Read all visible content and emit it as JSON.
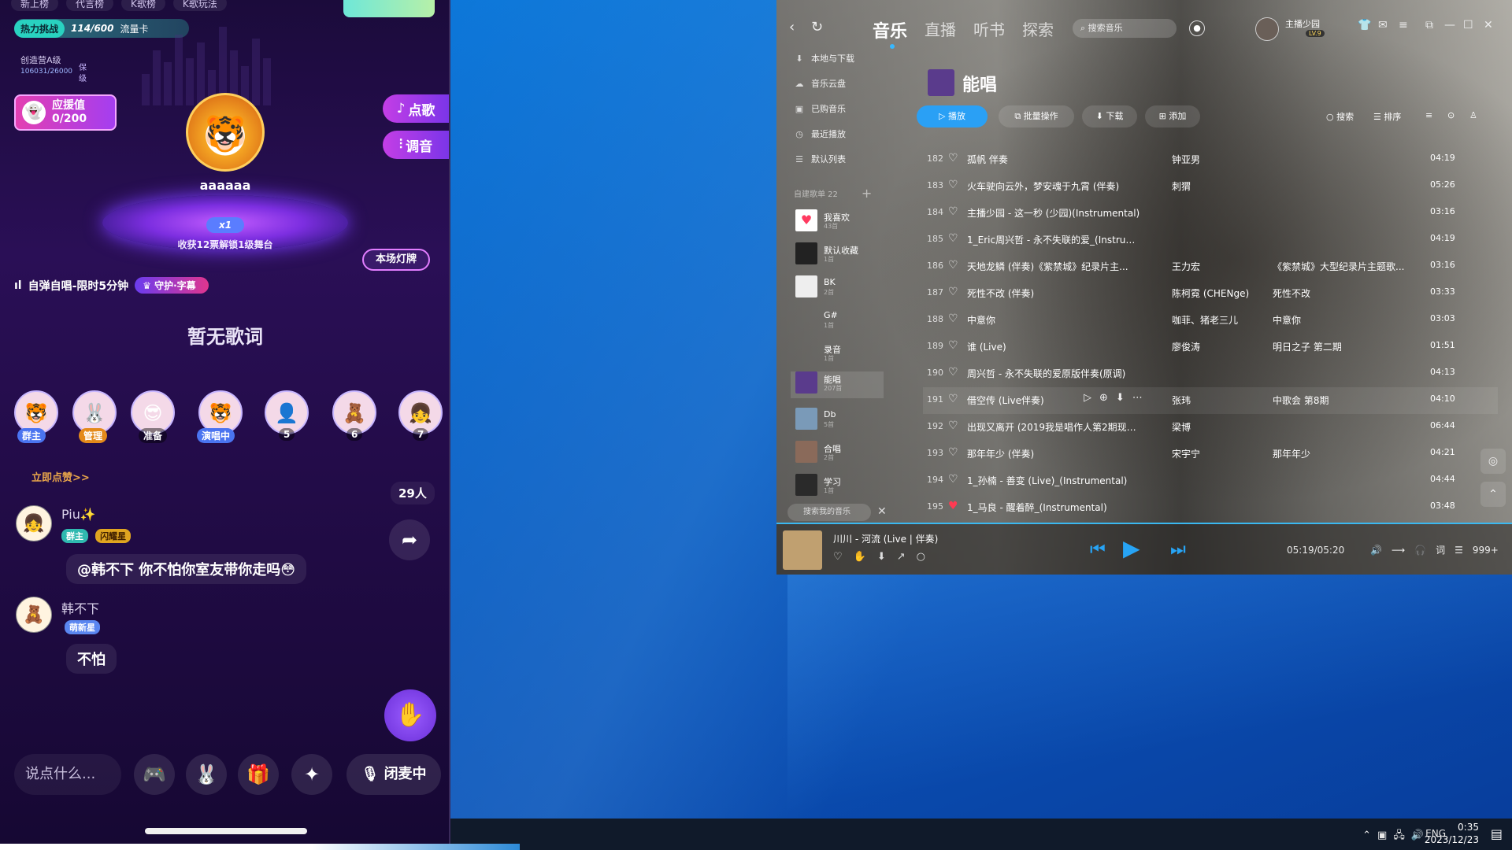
{
  "live_app": {
    "top_tabs": [
      "新上榜",
      "代言榜",
      "K歌榜",
      "K歌玩法"
    ],
    "hot_challenge": {
      "tag": "热力挑战",
      "count": "114/600",
      "card": "流量卡"
    },
    "rank": {
      "title": "创造营A级",
      "score": "106031/26000",
      "badge": "保级"
    },
    "support": {
      "label": "应援值",
      "value": "0/200"
    },
    "order_song": "点歌",
    "tune": "调音",
    "host_name": "aaaaaa",
    "stage_multiplier": "x1",
    "stage_text": "收获12票解锁1级舞台",
    "light_button": "本场灯牌",
    "self_sing": "自弹自唱-限时5分钟",
    "guard": "守护·字幕",
    "no_lyrics": "暂无歌词",
    "seats": [
      {
        "label": "群主",
        "avatar": "🐯"
      },
      {
        "label": "管理",
        "avatar": "🐰"
      },
      {
        "label": "准备",
        "avatar": "😎"
      },
      {
        "label": "演唱中",
        "avatar": "🐯"
      },
      {
        "label": "5",
        "avatar": "👤"
      },
      {
        "label": "6",
        "avatar": "🧸"
      },
      {
        "label": "7",
        "avatar": "👧"
      }
    ],
    "promo": "立即点赞>>",
    "people_count": "29人",
    "chat": [
      {
        "name": "Piu✨",
        "tags": [
          "群主",
          "闪耀星"
        ],
        "message": "@韩不下 你不怕你室友带你走吗😳"
      },
      {
        "name": "韩不下",
        "tags": [
          "萌新星"
        ],
        "message": "不怕"
      }
    ],
    "input_placeholder": "说点什么...",
    "mic_off": "闭麦中"
  },
  "music_player": {
    "tabs": [
      "音乐",
      "直播",
      "听书",
      "探索"
    ],
    "search_placeholder": "搜索音乐",
    "user": {
      "name": "主播少园",
      "level": "LV.9"
    },
    "sidebar": {
      "items": [
        "本地与下载",
        "音乐云盘",
        "已购音乐",
        "最近播放",
        "默认列表"
      ],
      "section": "自建歌单 22",
      "playlists": [
        {
          "name": "我喜欢",
          "count": "43首"
        },
        {
          "name": "默认收藏",
          "count": "1首"
        },
        {
          "name": "BK",
          "count": "2首"
        },
        {
          "name": "G#",
          "count": "1首"
        },
        {
          "name": "录音",
          "count": "1首"
        },
        {
          "name": "能唱",
          "count": "207首"
        },
        {
          "name": "Db",
          "count": "5首"
        },
        {
          "name": "合唱",
          "count": "2首"
        },
        {
          "name": "学习",
          "count": "1首"
        }
      ],
      "search_placeholder": "搜索我的音乐"
    },
    "playlist_title": "能唱",
    "actions": {
      "play": "播放",
      "batch": "批量操作",
      "download": "下载",
      "add": "添加"
    },
    "tools": {
      "search": "搜索",
      "sort": "排序"
    },
    "songs": [
      {
        "no": "182",
        "title": "孤帆 伴奏",
        "artist": "钟亚男",
        "album": "",
        "duration": "04:19"
      },
      {
        "no": "183",
        "title": "火车驶向云外，梦安魂于九霄 (伴奏)",
        "artist": "刺猬",
        "album": "",
        "duration": "05:26"
      },
      {
        "no": "184",
        "title": "主播少园 - 这一秒 (少园)(Instrumental)",
        "artist": "",
        "album": "",
        "duration": "03:16"
      },
      {
        "no": "185",
        "title": "1_Eric周兴哲 - 永不失联的爱_(Instrument...",
        "artist": "",
        "album": "",
        "duration": "04:19"
      },
      {
        "no": "186",
        "title": "天地龙鳞 (伴奏)《紫禁城》纪录片主...",
        "artist": "王力宏",
        "album": "《紫禁城》大型纪录片主题歌...",
        "duration": "03:16"
      },
      {
        "no": "187",
        "title": "死性不改 (伴奏)",
        "artist": "陈柯霓 (CHENge)",
        "album": "死性不改",
        "duration": "03:33"
      },
      {
        "no": "188",
        "title": "中意你",
        "artist": "咖菲、猪老三儿",
        "album": "中意你",
        "duration": "03:03"
      },
      {
        "no": "189",
        "title": "谁 (Live)",
        "artist": "廖俊涛",
        "album": "明日之子 第二期",
        "duration": "01:51"
      },
      {
        "no": "190",
        "title": "周兴哲 - 永不失联的爱原版伴奏(原调)",
        "artist": "",
        "album": "",
        "duration": "04:13"
      },
      {
        "no": "191",
        "title": "借空传 (Live伴奏)",
        "artist": "张玮",
        "album": "中歌会 第8期",
        "duration": "04:10"
      },
      {
        "no": "192",
        "title": "出现又离开 (2019我是唱作人第2期现场伴...",
        "artist": "梁博",
        "album": "",
        "duration": "06:44"
      },
      {
        "no": "193",
        "title": "那年年少 (伴奏)",
        "artist": "宋宇宁",
        "album": "那年年少",
        "duration": "04:21"
      },
      {
        "no": "194",
        "title": "1_孙楠 - 善变 (Live)_(Instrumental)",
        "artist": "",
        "album": "",
        "duration": "04:44"
      },
      {
        "no": "195",
        "title": "1_马良 - 醒着醉_(Instrumental)",
        "artist": "",
        "album": "",
        "duration": "03:48"
      }
    ],
    "now_playing": {
      "title": "川川 - 河流 (Live | 伴奏)",
      "time": "05:19/05:20",
      "lyric": "词",
      "count": "999+"
    }
  },
  "taskbar": {
    "ime": "ENG",
    "time": "0:35",
    "date": "2023/12/23"
  }
}
